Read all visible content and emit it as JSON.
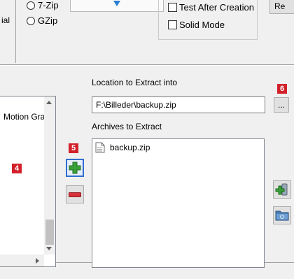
{
  "top": {
    "partial_left_label": "ial",
    "format_radio_7zip": "7-Zip",
    "format_radio_gzip": "GZip",
    "check_test_after": "Test After Creation",
    "check_solid_mode": "Solid Mode",
    "partial_right_button": "Re"
  },
  "left_list": {
    "item_partial": "Motion Gra"
  },
  "badges": {
    "b4": "4",
    "b5": "5",
    "b6": "6"
  },
  "extract": {
    "location_label": "Location to Extract into",
    "location_value": "F:\\Billeder\\backup.zip",
    "browse_label": "...",
    "archives_label": "Archives to Extract",
    "archives": [
      "backup.zip"
    ]
  },
  "colors": {
    "badge_red": "#d2212a",
    "add_green": "#3aa03a",
    "remove_red": "#d9313b"
  }
}
